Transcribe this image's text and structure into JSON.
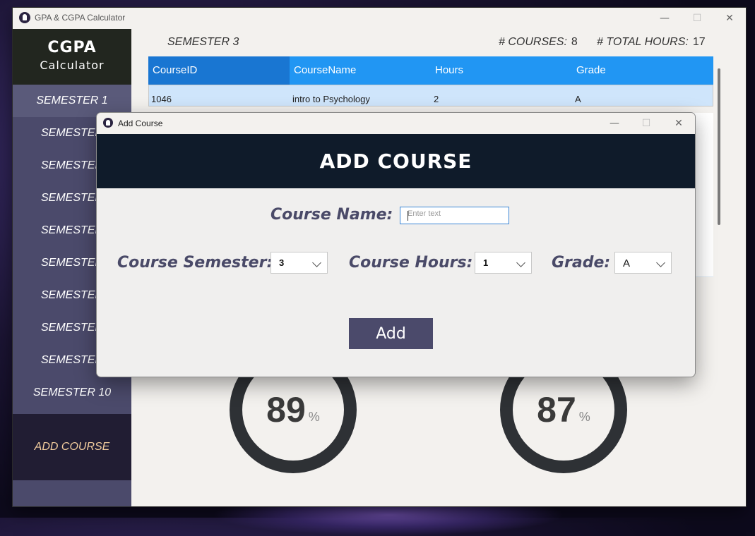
{
  "main_window": {
    "title": "GPA & CGPA Calculator",
    "controls": {
      "minimize": "—",
      "maximize": "☐",
      "close": "✕"
    }
  },
  "sidebar": {
    "logo_line1": "CGPA",
    "logo_line2": "Calculator",
    "items": [
      {
        "label": "SEMESTER 1"
      },
      {
        "label": "SEMESTER"
      },
      {
        "label": "SEMESTER"
      },
      {
        "label": "SEMESTER"
      },
      {
        "label": "SEMESTER"
      },
      {
        "label": "SEMESTER"
      },
      {
        "label": "SEMESTER"
      },
      {
        "label": "SEMESTER"
      },
      {
        "label": "SEMESTER"
      },
      {
        "label": "SEMESTER 10"
      }
    ],
    "add_course_label": "ADD COURSE"
  },
  "content": {
    "semester_label": "SEMESTER 3",
    "courses_label": "# COURSES:",
    "courses_value": "8",
    "hours_label": "# TOTAL HOURS:",
    "hours_value": "17",
    "table": {
      "headers": [
        "CourseID",
        "CourseName",
        "Hours",
        "Grade"
      ],
      "rows": [
        {
          "id": "1046",
          "name": "intro to Psychology",
          "hours": "2",
          "grade": "A"
        }
      ]
    },
    "gauges": [
      {
        "value": "89",
        "unit": "%"
      },
      {
        "value": "87",
        "unit": "%"
      }
    ]
  },
  "dialog": {
    "title": "Add Course",
    "banner": "ADD COURSE",
    "course_name_label": "Course Name:",
    "course_name_placeholder": "Enter text",
    "course_semester_label": "Course Semester:",
    "course_semester_value": "3",
    "course_hours_label": "Course Hours:",
    "course_hours_value": "1",
    "grade_label": "Grade:",
    "grade_value": "A",
    "add_button": "Add"
  }
}
